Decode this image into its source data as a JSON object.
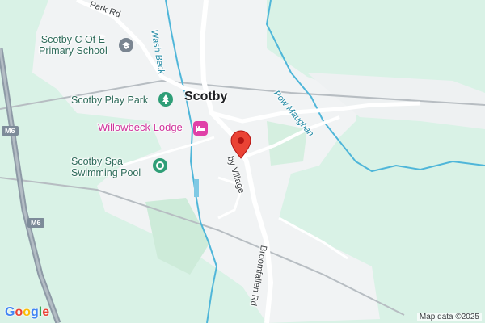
{
  "map": {
    "places": {
      "village": "Scotby"
    },
    "pois": {
      "school": "Scotby C Of E\nPrimary School",
      "play_park": "Scotby Play Park",
      "lodge": "Willowbeck Lodge",
      "swimming_pool": "Scotby Spa\nSwimming Pool"
    },
    "roads": {
      "park_rd": "Park Rd",
      "scotby_village": "by Village",
      "broomfallen_rd": "Broomfallen Rd",
      "m6_top": "M6",
      "m6_bottom": "M6"
    },
    "water": {
      "wash_beck": "Wash Beck",
      "pow_maughan": "Pow Maughan"
    },
    "icons": {
      "school": "school-icon",
      "park": "tree-icon",
      "lodge": "bed-icon",
      "pool": "pool-icon",
      "marker": "location-pin-icon"
    },
    "colors": {
      "land": "#d9f2e6",
      "urban": "#f1f3f4",
      "water": "#4fb6d9",
      "motorway": "#8e9aa6",
      "marker": "#ea4335"
    }
  },
  "branding": {
    "logo": [
      "G",
      "o",
      "o",
      "g",
      "l",
      "e"
    ],
    "logo_colors": [
      "#4285f4",
      "#ea4335",
      "#fbbc05",
      "#4285f4",
      "#34a853",
      "#ea4335"
    ],
    "attribution": "Map data ©2025"
  }
}
